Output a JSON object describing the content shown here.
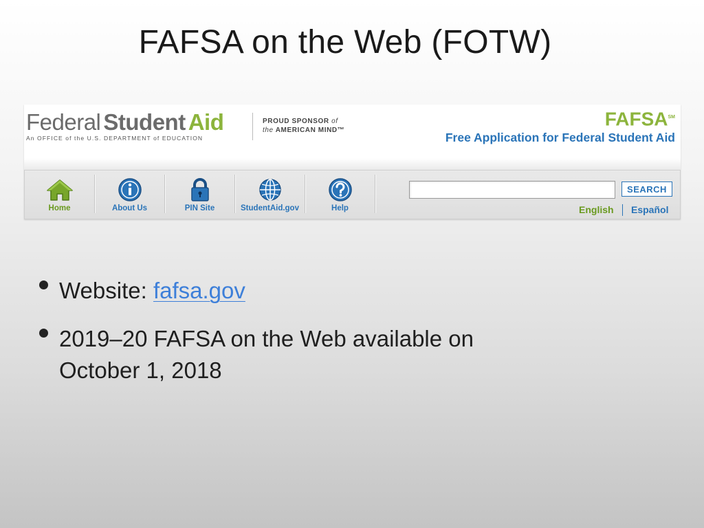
{
  "slide": {
    "title": "FAFSA on the Web (FOTW)"
  },
  "site": {
    "logo": {
      "federal": "Federal",
      "student": "Student",
      "aid": "Aid",
      "tagline": "An OFFICE of the U.S. DEPARTMENT of EDUCATION"
    },
    "sponsor": {
      "line1_a": "PROUD SPONSOR",
      "line1_b": "of",
      "line2_a": "the",
      "line2_b": "AMERICAN MIND™"
    },
    "fafsa": {
      "word": "FAFSA",
      "mark": "SM",
      "subtitle": "Free Application for Federal Student Aid"
    },
    "nav": [
      {
        "label": "Home",
        "icon": "home-icon"
      },
      {
        "label": "About Us",
        "icon": "info-icon"
      },
      {
        "label": "PIN Site",
        "icon": "lock-icon"
      },
      {
        "label": "StudentAid.gov",
        "icon": "globe-icon"
      },
      {
        "label": "Help",
        "icon": "help-icon"
      }
    ],
    "search": {
      "value": "",
      "button": "SEARCH"
    },
    "languages": {
      "english": "English",
      "spanish": "Español"
    },
    "colors": {
      "green": "#8cb43c",
      "blue": "#2a74b8"
    }
  },
  "bullets": {
    "b1_label": "Website:",
    "b1_link": "fafsa.gov",
    "b2_line1": "2019–20 FAFSA on the Web available on",
    "b2_line2": "October 1, 2018"
  }
}
